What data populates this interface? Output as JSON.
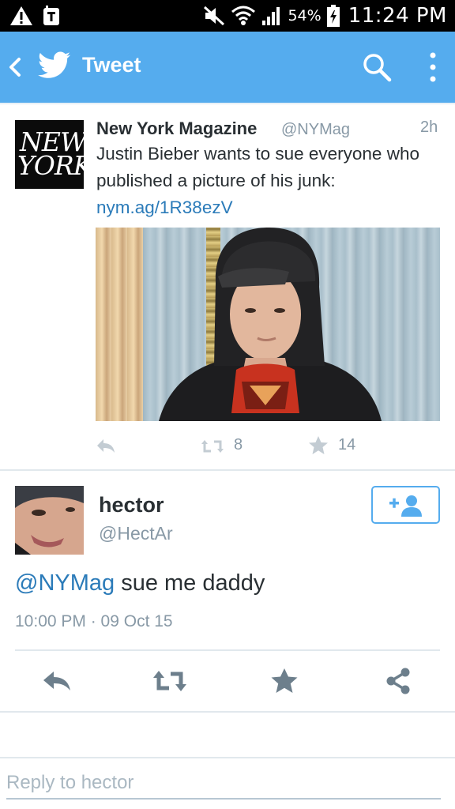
{
  "status_bar": {
    "battery": "54%",
    "time": "11:24 PM",
    "icons": [
      "warning-icon",
      "tmobile-icon",
      "mute-icon",
      "wifi-icon",
      "signal-icon",
      "battery-icon"
    ]
  },
  "app_bar": {
    "title": "Tweet",
    "icons": [
      "back-icon",
      "twitter-bird-icon",
      "search-icon",
      "more-vert-icon"
    ],
    "color": "#55acee"
  },
  "quoted_tweet": {
    "avatar_text_line1": "NEW",
    "avatar_text_line2": "YORK",
    "name": "New York Magazine",
    "handle": "@NYMag",
    "time": "2h",
    "text": "Justin Bieber wants to sue everyone who published a picture of his junk:",
    "link": "nym.ag/1R38ezV",
    "retweets": "8",
    "favorites": "14"
  },
  "tweet": {
    "name": "hector",
    "handle": "@HectAr",
    "mention": "@NYMag",
    "text": " sue me daddy",
    "timestamp": "10:00 PM · 09 Oct 15"
  },
  "reply": {
    "placeholder": "Reply to hector"
  },
  "colors": {
    "accent": "#55acee",
    "link": "#2b7bb9",
    "muted": "#8899a6",
    "text": "#292f33"
  }
}
